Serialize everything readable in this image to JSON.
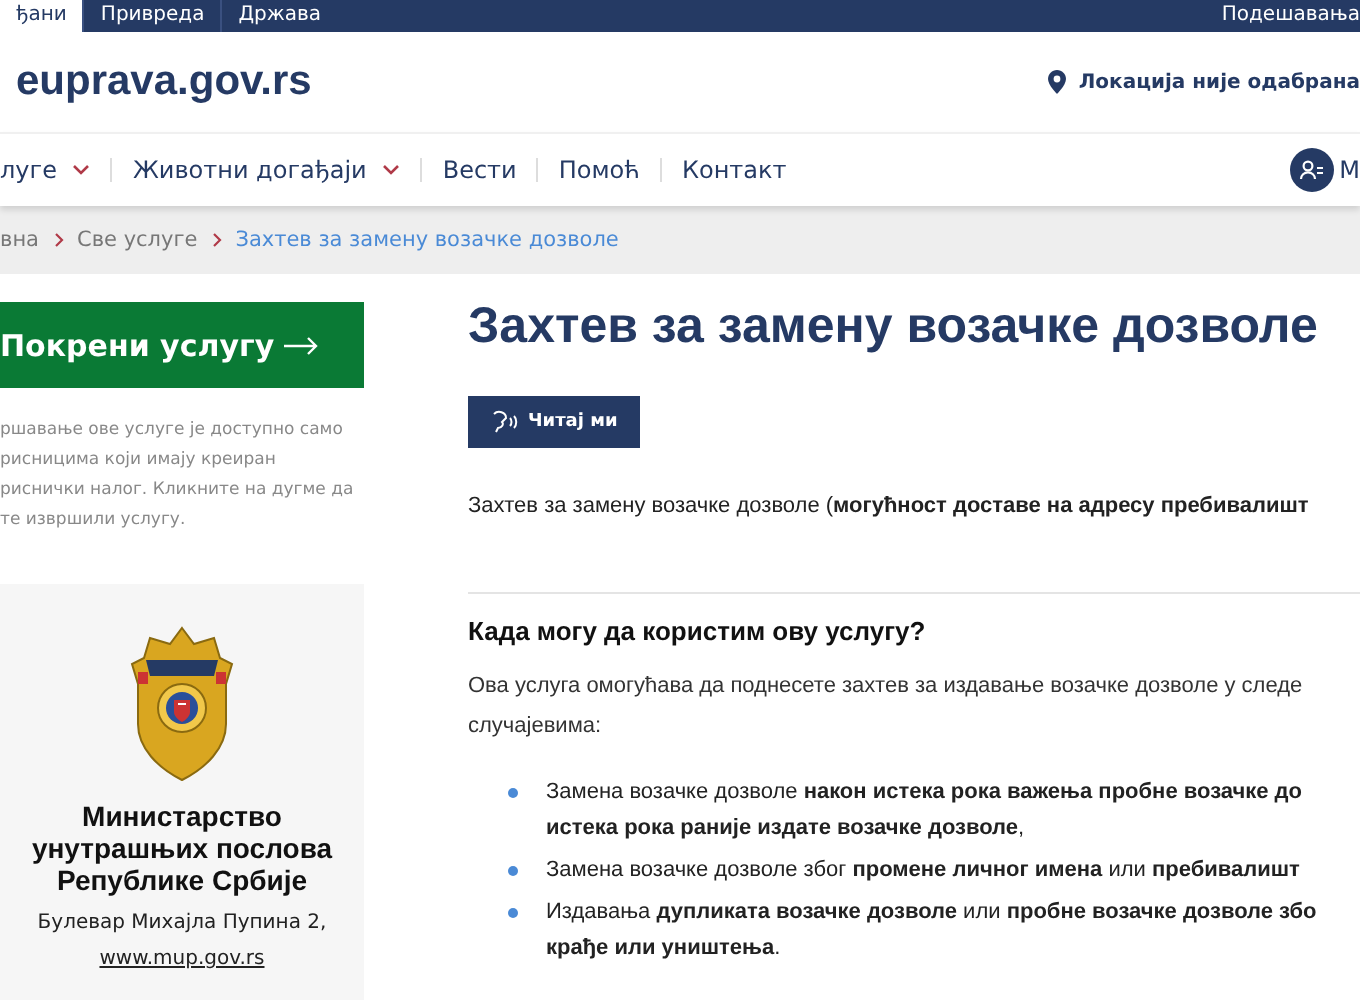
{
  "top_bar": {
    "tabs": [
      {
        "label": "ђани",
        "selected": true
      },
      {
        "label": "Привреда",
        "selected": false
      },
      {
        "label": "Држава",
        "selected": false
      }
    ],
    "settings": "Подешавања"
  },
  "header": {
    "logo": "euprava.gov.rs",
    "location": "Локација није одабрана"
  },
  "nav": {
    "items": [
      {
        "label": "луге",
        "dropdown": true
      },
      {
        "label": "Животни догађаји",
        "dropdown": true
      },
      {
        "label": "Вести",
        "dropdown": false
      },
      {
        "label": "Помоћ",
        "dropdown": false
      },
      {
        "label": "Контакт",
        "dropdown": false
      }
    ],
    "account": "М"
  },
  "breadcrumb": [
    {
      "label": "вна",
      "current": false
    },
    {
      "label": "Све услуге",
      "current": false
    },
    {
      "label": "Захтев за замену возачке дозволе",
      "current": true
    }
  ],
  "sidebar": {
    "start_button": "Покрени услугу",
    "notice": [
      "ршавање ове услуге је доступно само",
      "рисницима који имају креиран",
      "риснички налог. Кликните на дугме да",
      "те извршили услугу."
    ],
    "institution": {
      "name": "Министарство унутрашњих послова Републике Србије",
      "address": "Булевар Михајла Пупина 2,",
      "website": "www.mup.gov.rs"
    }
  },
  "main": {
    "title": "Захтев за замену возачке дозволе",
    "read_button": "Читај ми",
    "intro": "Захтев за замену возачке дозволе (**могућност доставе на адресу пребивалишт**",
    "section_title": "Када могу да користим ову услугу?",
    "section_text": [
      "Ова услуга омогућава да поднесете захтев за издавање возачке дозволе у следе",
      "случајевима:"
    ],
    "bullets": [
      {
        "lines": [
          "Замена возачке дозволе **након истека рока важења пробне возачке до**",
          "**истека рока раније издате возачке дозволе**,"
        ]
      },
      {
        "lines": [
          "Замена возачке дозволе због **промене личног имена** или **пребивалишт**"
        ]
      },
      {
        "lines": [
          "Издавања **дупликата возачке дозволе** или **пробне возачке дозволе збо**",
          "**крађе или уништења**."
        ]
      }
    ]
  }
}
